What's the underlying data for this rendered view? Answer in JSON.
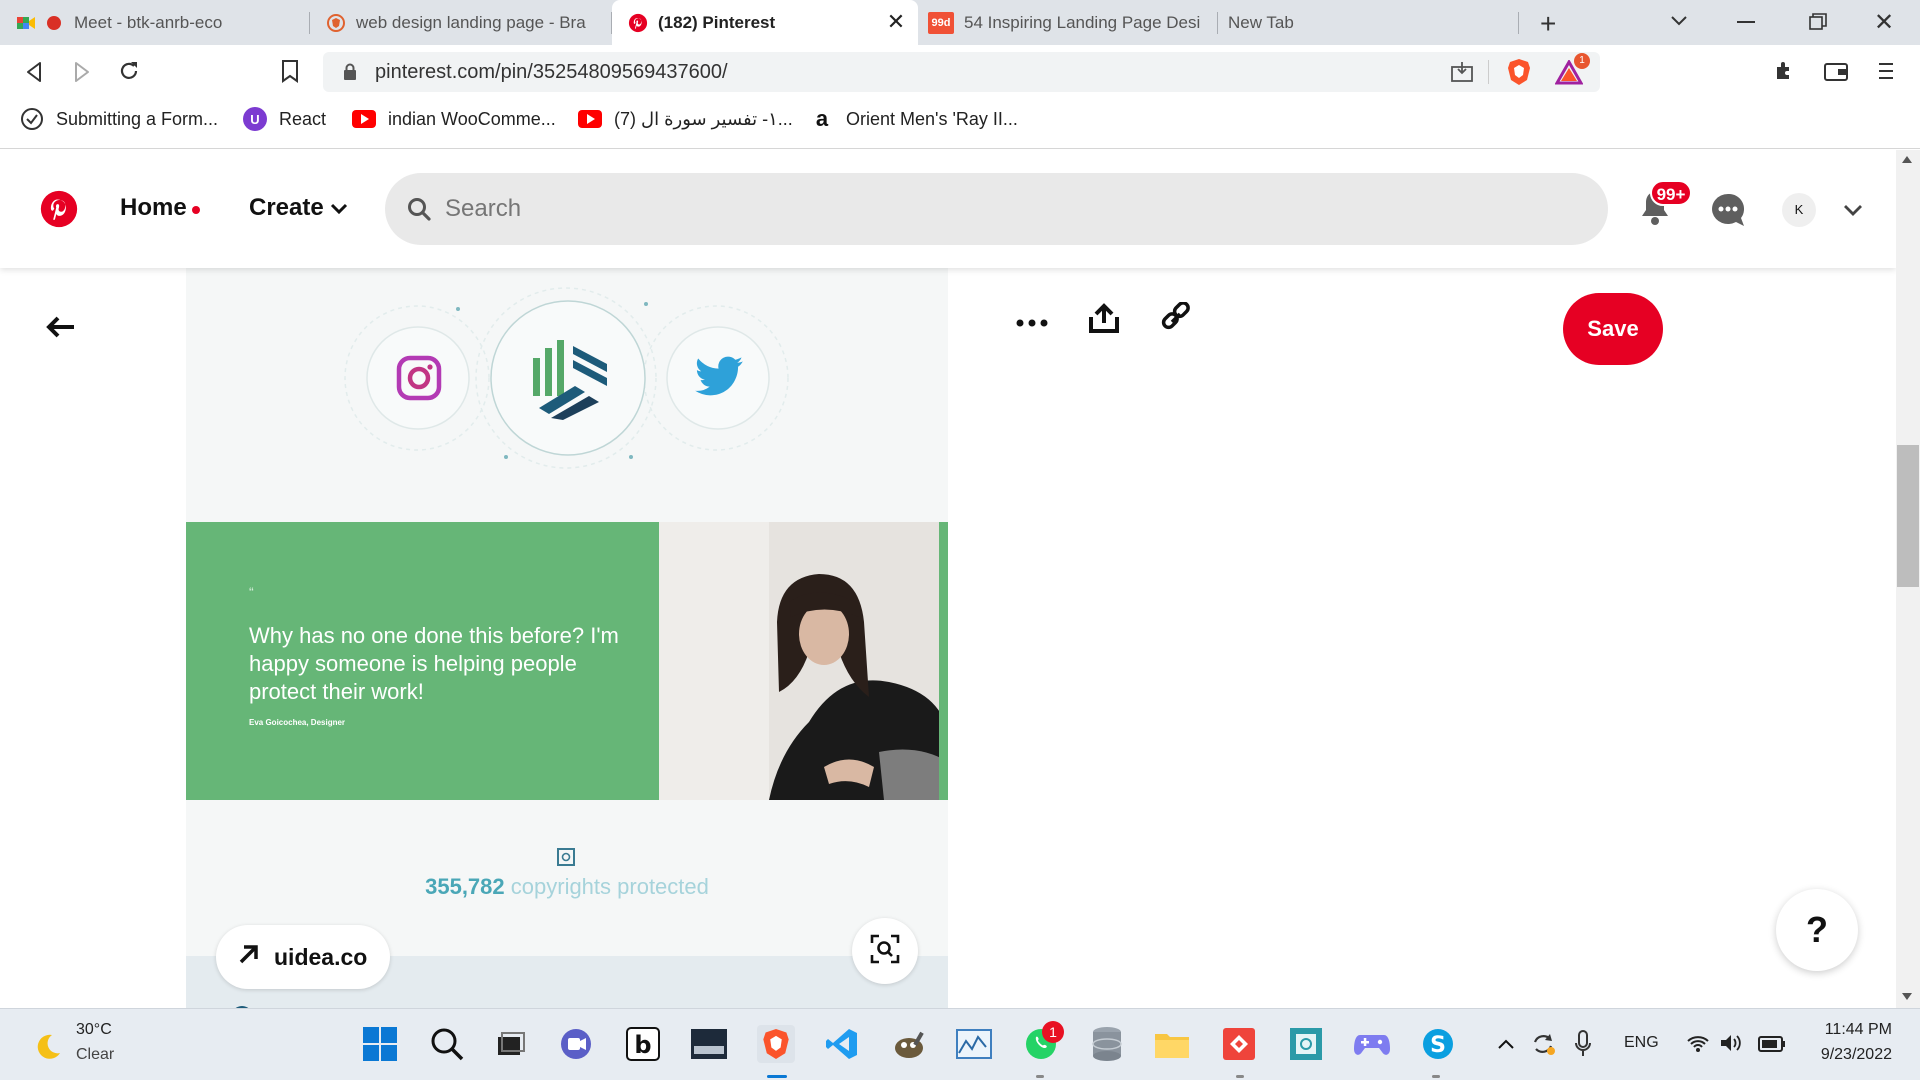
{
  "tabs": [
    {
      "title": "Meet - btk-anrb-eco",
      "icon": "google-meet-icon"
    },
    {
      "title": "web design landing page - Bra",
      "icon": "brave-search-icon"
    },
    {
      "title": "(182) Pinterest",
      "icon": "pinterest-icon",
      "active": true
    },
    {
      "title": "54 Inspiring Landing Page Desi",
      "icon": "99designs-icon",
      "favicon_text": "99d"
    },
    {
      "title": "New Tab",
      "icon": "none"
    }
  ],
  "address": {
    "url": "pinterest.com/pin/35254809569437600/",
    "rewards_badge": "1"
  },
  "bookmarks": [
    {
      "label": "Submitting a Form...",
      "icon": "check-circle-icon"
    },
    {
      "label": "React",
      "icon": "react-bookmark-icon",
      "favicon_text": "U"
    },
    {
      "label": "indian WooComme...",
      "icon": "youtube-icon"
    },
    {
      "label": "(7) ١- تفسير سورة ال...",
      "icon": "youtube-icon"
    },
    {
      "label": "Orient Men's 'Ray II...",
      "icon": "amazon-icon",
      "favicon_text": "a"
    }
  ],
  "header": {
    "home_label": "Home",
    "create_label": "Create",
    "search_placeholder": "Search",
    "notifications_badge": "99+",
    "avatar_initial": "K"
  },
  "pin": {
    "quote_mark": "“",
    "quote": "Why has no one done this before? I'm happy someone is helping people protect their work!",
    "quote_author": "Eva Goicochea, Designer",
    "stat_number": "355,782",
    "stat_text": "copyrights protected",
    "source": "uidea.co",
    "save_label": "Save",
    "help_label": "?"
  },
  "taskbar": {
    "weather_temp": "30°C",
    "weather_desc": "Clear",
    "whatsapp_badge": "1",
    "language": "ENG",
    "time": "11:44 PM",
    "date": "9/23/2022"
  },
  "colors": {
    "pinterest_red": "#e60023",
    "green_band": "#66b677",
    "stat_teal": "#4aa7b7"
  }
}
